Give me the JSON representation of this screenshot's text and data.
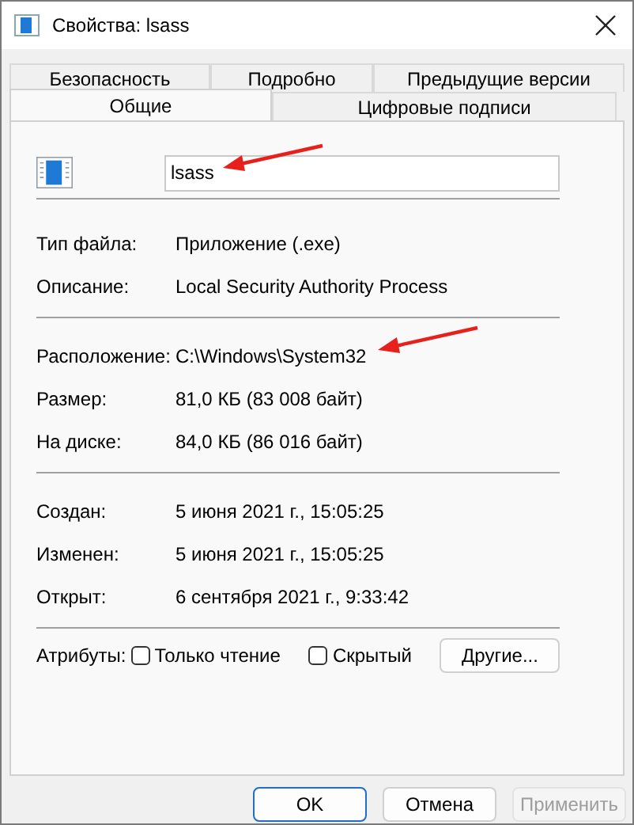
{
  "window": {
    "title": "Свойства: lsass"
  },
  "tab_rows": [
    [
      {
        "label": "Безопасность",
        "selected": false
      },
      {
        "label": "Подробно",
        "selected": false
      },
      {
        "label": "Предыдущие версии",
        "selected": false
      }
    ],
    [
      {
        "label": "Общие",
        "selected": true
      },
      {
        "label": "Цифровые подписи",
        "selected": false
      }
    ]
  ],
  "name_field": {
    "value": "lsass",
    "arrow": true
  },
  "sections": [
    [
      {
        "label": "Тип файла:",
        "value": "Приложение (.exe)",
        "arrow": false
      },
      {
        "label": "Описание:",
        "value": "Local Security Authority Process",
        "arrow": false
      }
    ],
    [
      {
        "label": "Расположение:",
        "value": "C:\\Windows\\System32",
        "arrow": true
      },
      {
        "label": "Размер:",
        "value": "81,0 КБ (83 008 байт)",
        "arrow": false
      },
      {
        "label": "На диске:",
        "value": "84,0 КБ (86 016 байт)",
        "arrow": false
      }
    ],
    [
      {
        "label": "Создан:",
        "value": "5 июня 2021 г., 15:05:25",
        "arrow": false
      },
      {
        "label": "Изменен:",
        "value": "5 июня 2021 г., 15:05:25",
        "arrow": false
      },
      {
        "label": "Открыт:",
        "value": "6 сентября 2021 г., 9:33:42",
        "arrow": false
      }
    ]
  ],
  "attributes": {
    "label": "Атрибуты:",
    "checkboxes": [
      {
        "label": "Только чтение",
        "checked": false
      },
      {
        "label": "Скрытый",
        "checked": false
      }
    ],
    "button": "Другие..."
  },
  "buttons": [
    {
      "label": "OK",
      "default": true,
      "disabled": false
    },
    {
      "label": "Отмена",
      "default": false,
      "disabled": false
    },
    {
      "label": "Применить",
      "default": false,
      "disabled": true
    }
  ]
}
